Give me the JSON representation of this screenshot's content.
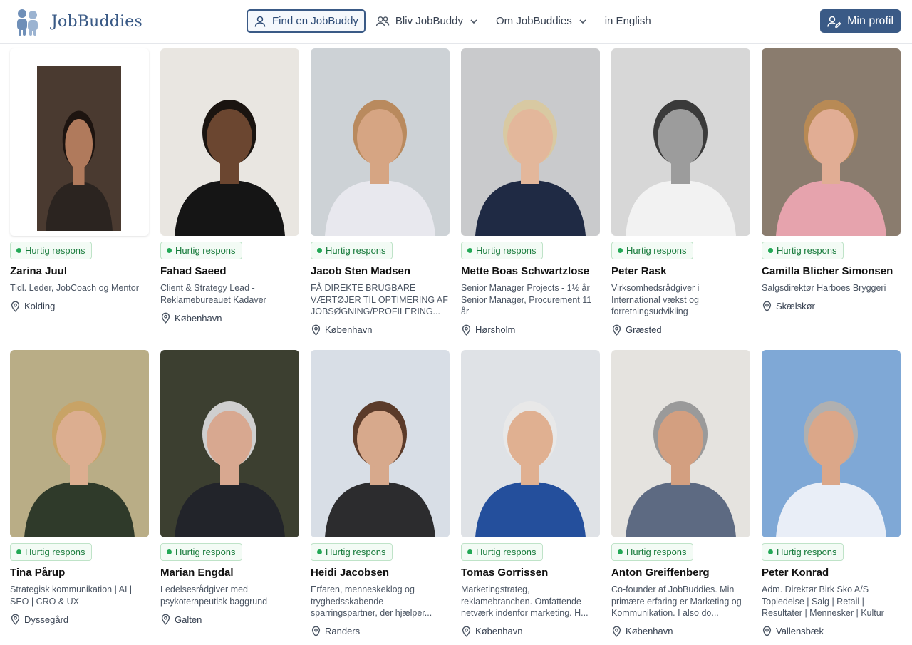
{
  "header": {
    "brand": "JobBuddies",
    "nav": {
      "find": "Find en JobBuddy",
      "become": "Bliv JobBuddy",
      "about": "Om JobBuddies",
      "english": "in English"
    },
    "profile": "Min profil"
  },
  "badge_label": "Hurtig respons",
  "colors": {
    "brand": "#3a5a86",
    "badge_green": "#22a855"
  },
  "cards": [
    {
      "name": "Zarina Juul",
      "title": "Tidl. Leder, JobCoach og Mentor",
      "location": "Kolding"
    },
    {
      "name": "Fahad Saeed",
      "title": "Client & Strategy Lead - Reklamebureauet Kadaver",
      "location": "København"
    },
    {
      "name": "Jacob Sten Madsen",
      "title": "FÅ DIREKTE BRUGBARE VÆRTØJER TIL OPTIMERING AF JOBSØGNING/PROFILERING...",
      "location": "København"
    },
    {
      "name": "Mette Boas Schwartzlose",
      "title": "Senior Manager Projects - 1½ år Senior Manager, Procurement 11 år",
      "location": "Hørsholm"
    },
    {
      "name": "Peter Rask",
      "title": "Virksomhedsrådgiver i International vækst og forretningsudvikling",
      "location": "Græsted"
    },
    {
      "name": "Camilla Blicher Simonsen",
      "title": "Salgsdirektør Harboes Bryggeri",
      "location": "Skælskør"
    },
    {
      "name": "Tina Pårup",
      "title": "Strategisk kommunikation | AI | SEO | CRO & UX",
      "location": "Dyssegård"
    },
    {
      "name": "Marian Engdal",
      "title": "Ledelsesrådgiver med psykoterapeutisk baggrund",
      "location": "Galten"
    },
    {
      "name": "Heidi Jacobsen",
      "title": "Erfaren, menneskeklog og tryghedsskabende sparringspartner, der hjælper...",
      "location": "Randers"
    },
    {
      "name": "Tomas Gorrissen",
      "title": "Marketingstrateg, reklamebranchen. Omfattende netværk indenfor marketing. H...",
      "location": "København"
    },
    {
      "name": "Anton Greiffenberg",
      "title": "Co-founder af JobBuddies. Min primære erfaring er Marketing og Kommunikation. I also do...",
      "location": "København"
    },
    {
      "name": "Peter Konrad",
      "title": "Adm. Direktør Birk Sko A/S Topledelse | Salg | Retail | Resultater | Mennesker | Kultur",
      "location": "Vallensbæk"
    }
  ]
}
